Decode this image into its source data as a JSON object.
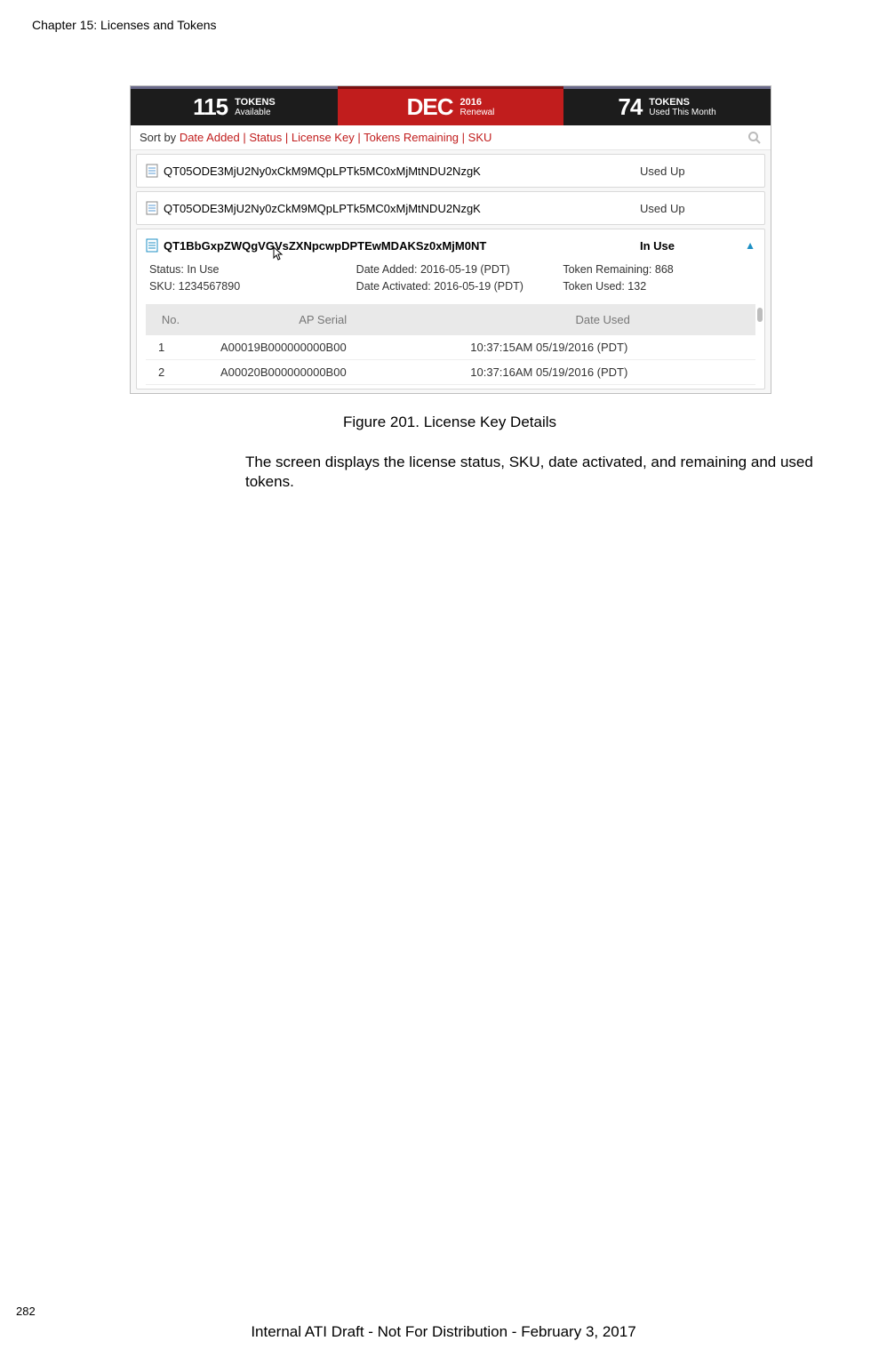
{
  "header": {
    "chapter": "Chapter 15: Licenses and Tokens"
  },
  "stats": {
    "tokens_available": {
      "value": "115",
      "label_top": "TOKENS",
      "label_bottom": "Available"
    },
    "renewal": {
      "value": "DEC",
      "label_top": "2016",
      "label_bottom": "Renewal"
    },
    "tokens_used": {
      "value": "74",
      "label_top": "TOKENS",
      "label_bottom": "Used This Month"
    }
  },
  "sort": {
    "prefix": "Sort by ",
    "links": [
      "Date Added",
      "Status",
      "License Key",
      "Tokens Remaining",
      "SKU"
    ]
  },
  "licenses": [
    {
      "key": "QT05ODE3MjU2Ny0xCkM9MQpLPTk5MC0xMjMtNDU2NzgK",
      "status": "Used Up"
    },
    {
      "key": "QT05ODE3MjU2Ny0zCkM9MQpLPTk5MC0xMjMtNDU2NzgK",
      "status": "Used Up"
    }
  ],
  "expanded": {
    "key": "QT1BbGxpZWQgVGVsZXNpcwpDPTEwMDAKSz0xMjM0NT",
    "status": "In Use",
    "details": {
      "col1": {
        "status": "Status: In Use",
        "sku": "SKU: 1234567890"
      },
      "col2": {
        "added": "Date Added: 2016-05-19 (PDT)",
        "activated": "Date Activated: 2016-05-19 (PDT)"
      },
      "col3": {
        "remaining": "Token Remaining: 868",
        "used": "Token Used: 132"
      }
    },
    "table": {
      "headers": {
        "no": "No.",
        "serial": "AP Serial",
        "date": "Date Used"
      },
      "rows": [
        {
          "no": "1",
          "serial": "A00019B000000000B00",
          "date": "10:37:15AM 05/19/2016 (PDT)"
        },
        {
          "no": "2",
          "serial": "A00020B000000000B00",
          "date": "10:37:16AM 05/19/2016 (PDT)"
        }
      ]
    }
  },
  "caption": "Figure 201. License Key Details",
  "paragraph": "The screen displays the license status, SKU, date activated, and remaining and used tokens.",
  "page_number": "282",
  "footer": "Internal ATI Draft - Not For Distribution - February 3, 2017"
}
